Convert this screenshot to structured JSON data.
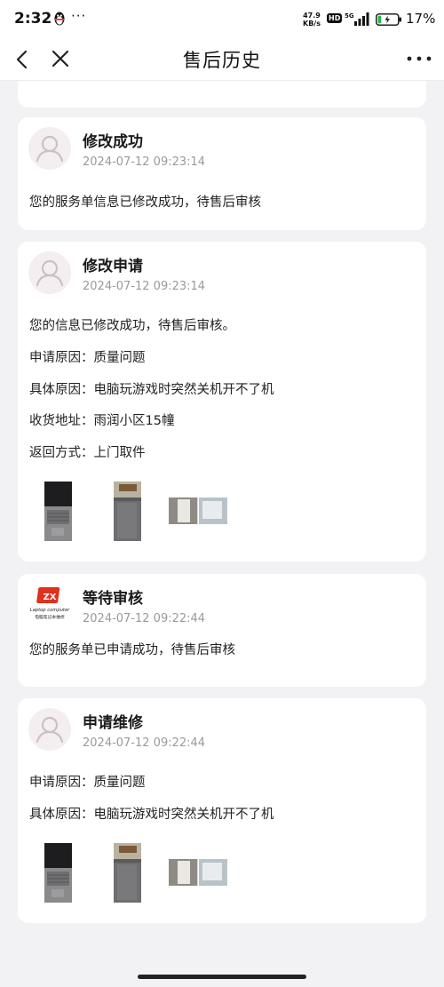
{
  "status_bar": {
    "time": "2:32",
    "dots": "···",
    "net_speed_value": "47.9",
    "net_speed_unit": "KB/s",
    "hd_badge": "HD",
    "signal": "5G",
    "battery_percent": "17%",
    "battery_level": 0.17
  },
  "nav": {
    "title": "售后历史"
  },
  "records": [
    {
      "title": "修改成功",
      "time": "2024-07-12 09:23:14",
      "lines": [
        "您的服务单信息已修改成功，待售后审核"
      ]
    },
    {
      "title": "修改申请",
      "time": "2024-07-12 09:23:14",
      "lines": [
        "您的信息已修改成功，待售后审核。",
        "申请原因：质量问题",
        "具体原因：电脑玩游戏时突然关机开不了机",
        "收货地址：雨润小区15幢",
        "返回方式：上门取件"
      ]
    },
    {
      "title": "等待审核",
      "time": "2024-07-12 09:22:44",
      "lines": [
        "您的服务单已申请成功，待售后审核"
      ],
      "logo_text": "ZX",
      "logo_caption": "Laptop computer",
      "logo_subcaption": "电脑笔记本维修"
    },
    {
      "title": "申请维修",
      "time": "2024-07-12 09:22:44",
      "lines": [
        "申请原因：质量问题",
        "具体原因：电脑玩游戏时突然关机开不了机"
      ]
    }
  ],
  "colors": {
    "background": "#f2f2f4",
    "card": "#ffffff",
    "time_text": "#9a9a9a",
    "avatar_bg": "#f4eef0",
    "logo_red": "#e0301e"
  }
}
